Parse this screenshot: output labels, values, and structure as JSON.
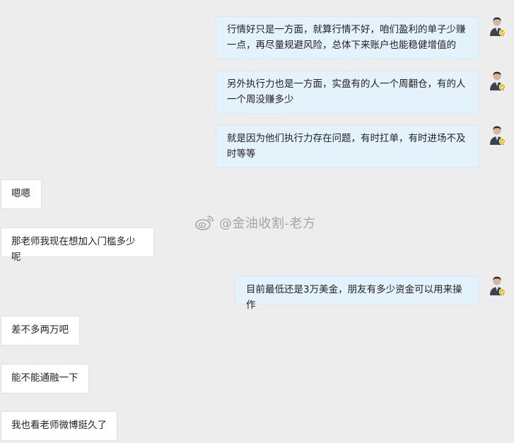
{
  "messages": [
    {
      "side": "right",
      "text": "行情好只是一方面，就算行情不好，咱们盈利的单子少赚一点，再尽量规避风险，总体下来账户也能稳健增值的"
    },
    {
      "side": "right",
      "text": "另外执行力也是一方面，实盘有的人一个周翻仓，有的人一个周没赚多少"
    },
    {
      "side": "right",
      "text": "就是因为他们执行力存在问题，有时扛单，有时进场不及时等等"
    },
    {
      "side": "left",
      "text": "嗯嗯"
    },
    {
      "side": "left",
      "text": "那老师我现在想加入门槛多少呢"
    },
    {
      "side": "right",
      "text": "目前最低还是3万美金，朋友有多少资金可以用来操作"
    },
    {
      "side": "left",
      "text": "差不多两万吧"
    },
    {
      "side": "left",
      "text": "能不能通融一下"
    },
    {
      "side": "left",
      "text": "我也看老师微博挺久了"
    }
  ],
  "watermark": {
    "text": "@金油收割-老方",
    "icon": "weibo-icon"
  },
  "avatar": {
    "icon": "teacher-avatar-icon",
    "badge_icon": "verified-badge-icon",
    "badge_color": "#f5b400"
  },
  "colors": {
    "background": "#ededed",
    "right_bubble": "#e4f2fc",
    "left_bubble": "#ffffff"
  }
}
